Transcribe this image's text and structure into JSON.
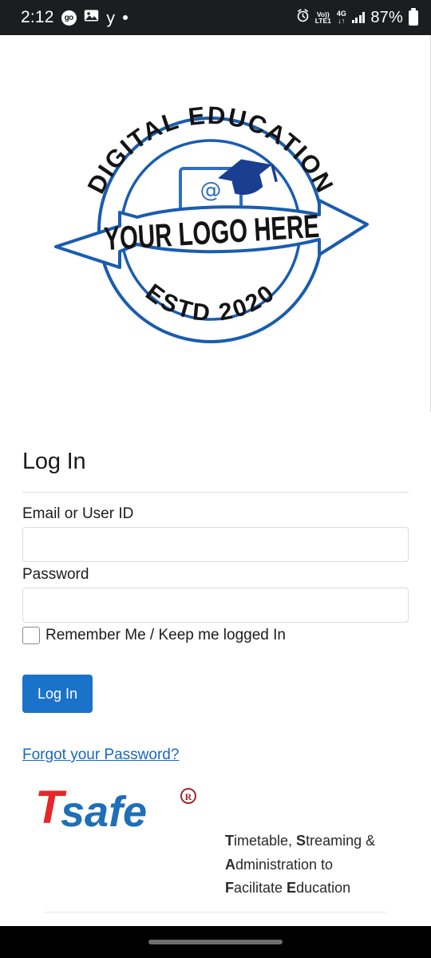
{
  "status_bar": {
    "clock": "2:12",
    "go_badge": "go",
    "icons": [
      "go-badge-icon",
      "photo-icon",
      "yahoo-y-icon",
      "dot-icon"
    ],
    "alarm": "alarm-icon",
    "volte_top": "Vo))",
    "volte_bottom": "LTE1",
    "network_top": "4G",
    "network_bottom": "↓↑",
    "battery_percent": "87%"
  },
  "logo": {
    "top_arc_text": "DIGITAL EDUCATION",
    "bottom_arc_text": "ESTD 2020",
    "banner_text": "YOUR LOGO HERE",
    "center_symbol": "@",
    "brand_blue": "#1a5cb0",
    "ink": "#1a1a1a"
  },
  "form": {
    "title": "Log In",
    "email_label": "Email or User ID",
    "email_value": "",
    "email_placeholder": "",
    "password_label": "Password",
    "password_value": "",
    "password_placeholder": "",
    "remember_label": "Remember Me / Keep me logged In",
    "remember_checked": false,
    "submit_label": "Log In",
    "forgot_label": "Forgot your Password?",
    "button_color": "#1a73c9",
    "link_color": "#1769c0"
  },
  "brand": {
    "name_t": "T",
    "name_rest": "safe",
    "registered_mark": "R",
    "t_color": "#e8262a",
    "safe_color": "#1d6fb8",
    "mark_color": "#9e2b2b",
    "tagline_lines": [
      {
        "bold": "T",
        "rest": "imetable, ",
        "bold2": "S",
        "rest2": "treaming &"
      },
      {
        "bold": "A",
        "rest": "dministration to"
      },
      {
        "bold": "F",
        "rest": "acilitate ",
        "bold2": "E",
        "rest2": "ducation"
      }
    ]
  },
  "nav_bar": {
    "home_indicator": "home-indicator"
  }
}
